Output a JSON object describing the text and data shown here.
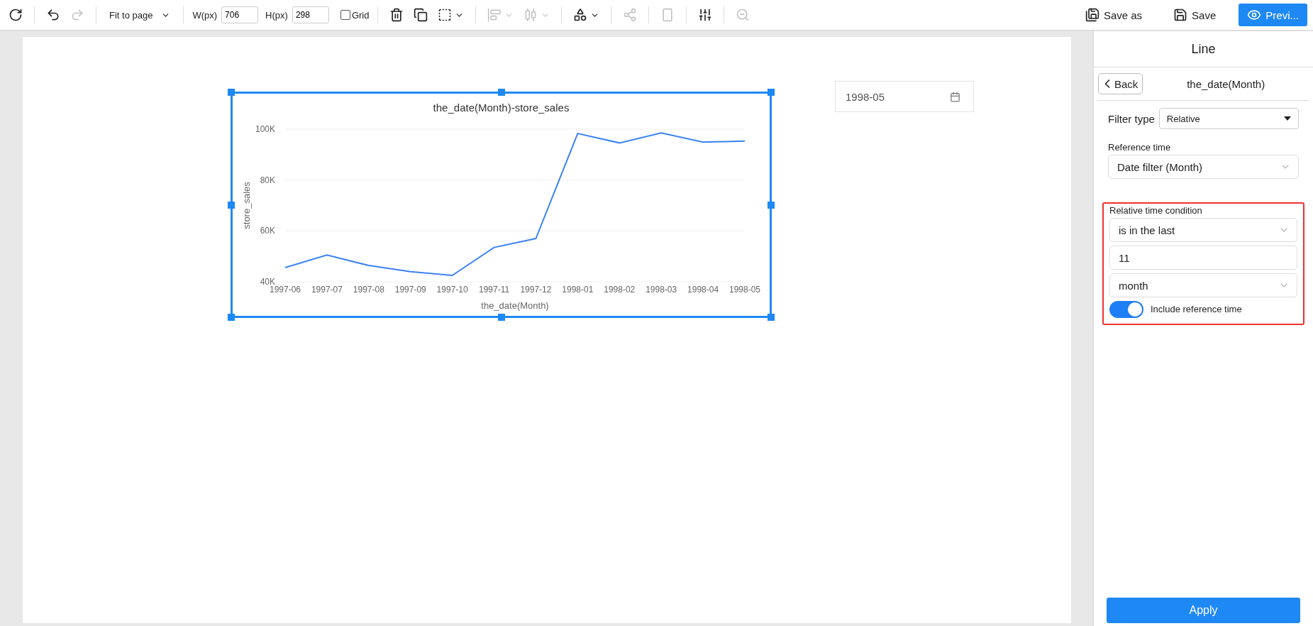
{
  "toolbar": {
    "icons_left": [
      {
        "disabled": false
      },
      {
        "disabled": false
      },
      {
        "disabled": true
      }
    ],
    "zoom_select": {
      "value": "Fit to page"
    },
    "width_field": {
      "label": "W(px)",
      "value": "706"
    },
    "height_field": {
      "label": "H(px)",
      "value": "298"
    },
    "grid": {
      "label": "Grid",
      "checked": false
    },
    "icons_right": [
      {
        "disabled": false,
        "dropdown": false
      },
      {
        "disabled": false,
        "dropdown": false
      },
      {
        "disabled": false,
        "dropdown": true
      },
      {
        "disabled": true,
        "dropdown": true
      },
      {
        "disabled": true,
        "dropdown": true
      },
      {
        "disabled": false,
        "dropdown": true
      },
      {
        "disabled": true,
        "dropdown": false
      },
      {
        "disabled": true,
        "dropdown": false
      },
      {
        "disabled": false,
        "dropdown": false
      },
      {
        "disabled": true,
        "dropdown": false
      }
    ],
    "actions": [
      {
        "label": "Save as",
        "kind": "plain"
      },
      {
        "label": "Save",
        "kind": "plain"
      },
      {
        "label": "Previ...",
        "kind": "primary"
      }
    ]
  },
  "canvas": {
    "chart_widget": {
      "selected": true,
      "chart_data": {
        "type": "line",
        "title": "the_date(Month)-store_sales",
        "xlabel": "the_date(Month)",
        "ylabel": "store_sales",
        "categories": [
          "1997-06",
          "1997-07",
          "1997-08",
          "1997-09",
          "1997-10",
          "1997-11",
          "1997-12",
          "1998-01",
          "1998-02",
          "1998-03",
          "1998-04",
          "1998-05"
        ],
        "series": [
          {
            "color": "#3b82f6",
            "values": [
              45600,
              50500,
              46400,
              44000,
              42500,
              53500,
              57000,
              98300,
              94600,
              98500,
              94900,
              95300
            ]
          }
        ],
        "ylim": [
          40000,
          100000
        ],
        "yticks": [
          {
            "value": 40000,
            "label": "40K"
          },
          {
            "value": 60000,
            "label": "60K"
          },
          {
            "value": 80000,
            "label": "80K"
          },
          {
            "value": 100000,
            "label": "100K"
          }
        ]
      }
    },
    "date_picker": {
      "value": "1998-05"
    }
  },
  "panel": {
    "title": "Line",
    "back_label": "Back",
    "field_title": "the_date(Month)",
    "filter_type": {
      "label": "Filter type",
      "value": "Relative"
    },
    "reference_time": {
      "label": "Reference time",
      "value": "Date filter (Month)"
    },
    "condition": {
      "label": "Relative time condition",
      "operator": "is in the last",
      "amount": "11",
      "unit": "month",
      "include_reference": {
        "label": "Include reference time",
        "on": true
      }
    },
    "apply_label": "Apply"
  }
}
